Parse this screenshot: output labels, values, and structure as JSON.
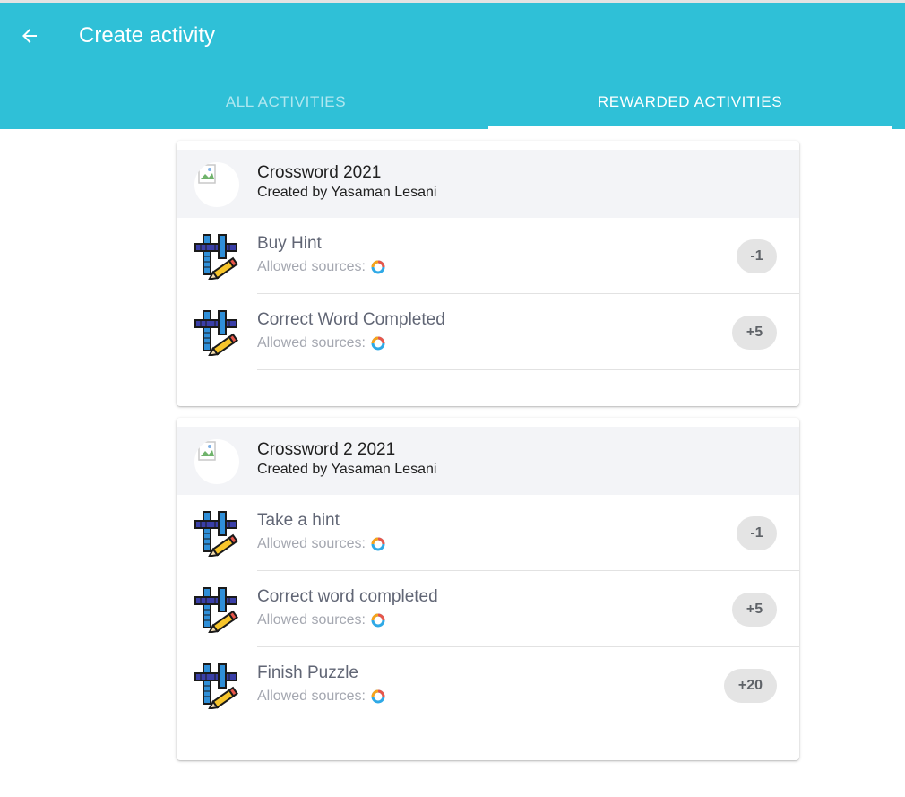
{
  "appbar": {
    "title": "Create activity",
    "back_icon": "arrow-left-icon",
    "color": "#2fc0d7"
  },
  "tabs": [
    {
      "label": "ALL ACTIVITIES",
      "active": false
    },
    {
      "label": "REWARDED ACTIVITIES",
      "active": true
    }
  ],
  "games": [
    {
      "title": "Crossword 2021",
      "creator": "Created by Yasaman Lesani",
      "activities": [
        {
          "name": "Buy Hint",
          "sources_label": "Allowed sources:",
          "points": "-1"
        },
        {
          "name": "Correct Word Completed",
          "sources_label": "Allowed sources:",
          "points": "+5"
        }
      ]
    },
    {
      "title": "Crossword 2 2021",
      "creator": "Created by Yasaman Lesani",
      "activities": [
        {
          "name": "Take a hint",
          "sources_label": "Allowed sources:",
          "points": "-1"
        },
        {
          "name": "Correct word completed",
          "sources_label": "Allowed sources:",
          "points": "+5"
        },
        {
          "name": "Finish Puzzle",
          "sources_label": "Allowed sources:",
          "points": "+20"
        }
      ]
    }
  ],
  "icons": {
    "activity_icon": "crossword-pencil-icon",
    "source_icon": "source-ring-icon",
    "thumb_icon": "broken-image-icon"
  }
}
